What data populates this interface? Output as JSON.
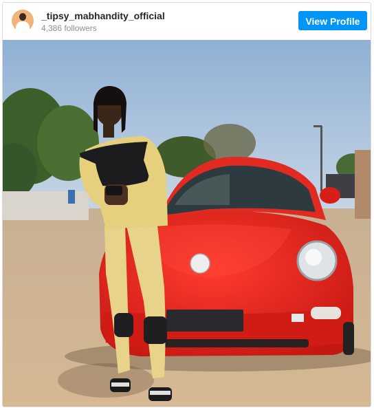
{
  "post": {
    "username": "_tipsy_mabhandity_official",
    "followers": "4,386 followers",
    "view_profile_label": "View Profile"
  },
  "colors": {
    "accent": "#0095f6",
    "car": "#e8251f",
    "sky": "#a9c3dc",
    "ground": "#c9ad8a"
  },
  "icons": {
    "avatar": "profile-photo"
  }
}
